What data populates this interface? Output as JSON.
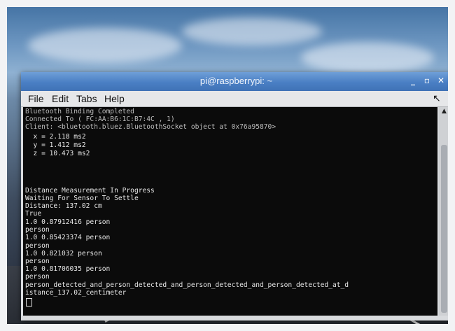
{
  "window": {
    "title": "pi@raspberrypi: ~",
    "controls": {
      "minimize": "_",
      "maximize": "▫",
      "close": "✕"
    }
  },
  "menubar": {
    "items": [
      {
        "label": "File"
      },
      {
        "label": "Edit"
      },
      {
        "label": "Tabs"
      },
      {
        "label": "Help"
      }
    ]
  },
  "terminal": {
    "lines": [
      "Bluetooth Binding Completed",
      "Connected To ( FC:AA:B6:1C:B7:4C , 1)",
      "Client: <bluetooth.bluez.BluetoothSocket object at 0x76a95870>",
      "  x = 2.118 ms2",
      "  y = 1.412 ms2",
      "  z = 10.473 ms2",
      "",
      "",
      "",
      "Distance Measurement In Progress",
      "Waiting For Sensor To Settle",
      "Distance: 137.02 cm",
      "True",
      "1.0 0.87912416 person",
      "person",
      "1.0 0.85423374 person",
      "person",
      "1.0 0.821032 person",
      "person",
      "1.0 0.81706035 person",
      "person",
      "person_detected_and_person_detected_and_person_detected_and_person_detected_at_d",
      "istance_137.02_centimeter"
    ]
  },
  "colors": {
    "titlebar": "#4a7fc4",
    "terminal_bg": "#0b0b0b",
    "terminal_fg": "#e8e8e8"
  },
  "icons": [
    "minimize-icon",
    "maximize-icon",
    "close-icon",
    "scroll-up-icon",
    "mouse-pointer-icon"
  ]
}
